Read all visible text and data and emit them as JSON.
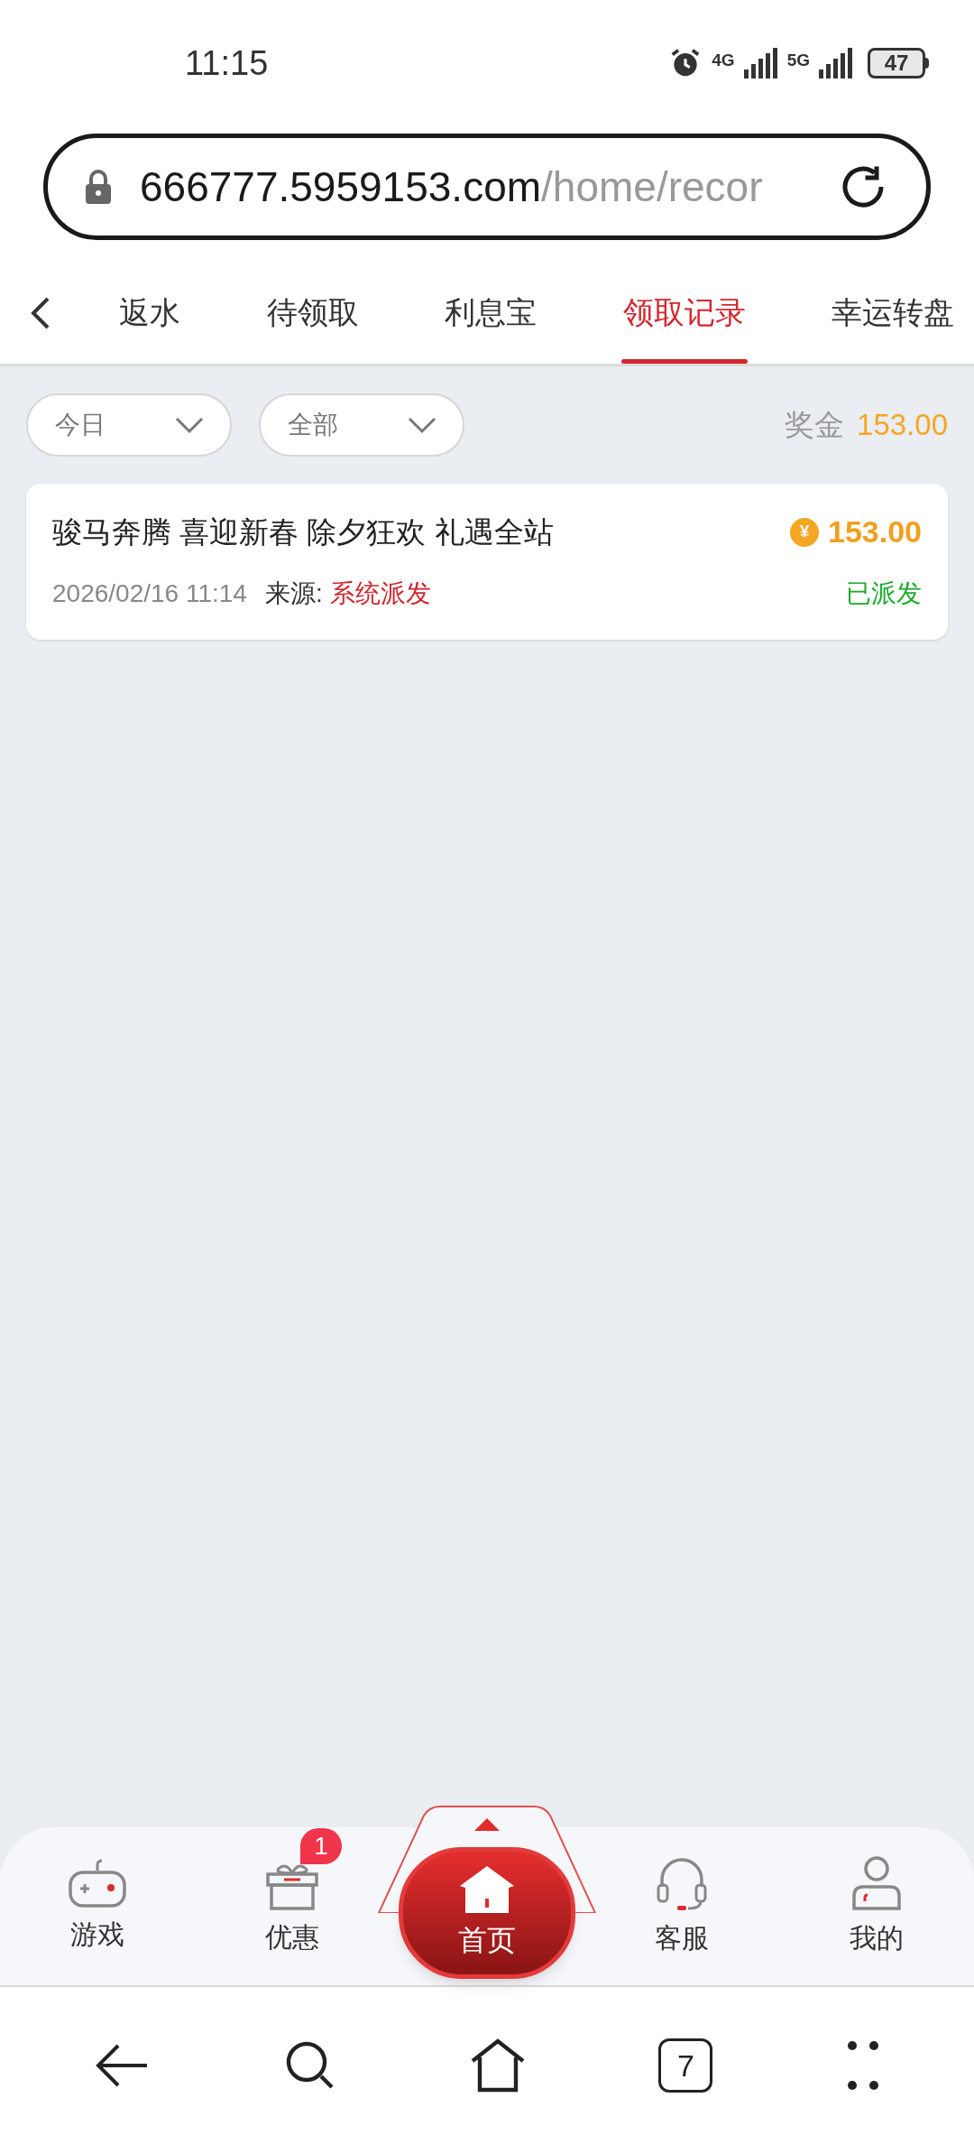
{
  "status_bar": {
    "time": "11:15",
    "network_1": "4G",
    "network_2": "5G",
    "battery": "47"
  },
  "address_bar": {
    "domain": "666777.5959153.com",
    "path": "/home/recor"
  },
  "tabs": [
    {
      "label": "返水",
      "selected": false
    },
    {
      "label": "待领取",
      "selected": false
    },
    {
      "label": "利息宝",
      "selected": false
    },
    {
      "label": "领取记录",
      "selected": true
    },
    {
      "label": "幸运转盘",
      "selected": false
    }
  ],
  "filters": [
    {
      "value": "今日"
    },
    {
      "value": "全部"
    }
  ],
  "bonus_total": {
    "label": "奖金",
    "amount": "153.00"
  },
  "records": [
    {
      "title": "骏马奔腾 喜迎新春 除夕狂欢 礼遇全站",
      "currency_symbol": "¥",
      "amount": "153.00",
      "time": "2026/02/16 11:14",
      "source_label": "来源:",
      "source": "系统派发",
      "status": "已派发"
    }
  ],
  "bottom_nav": [
    {
      "label": "游戏",
      "kind": "tab"
    },
    {
      "label": "优惠",
      "kind": "tab",
      "badge": "1"
    },
    {
      "label": "首页",
      "kind": "center"
    },
    {
      "label": "客服",
      "kind": "tab"
    },
    {
      "label": "我的",
      "kind": "tab"
    }
  ],
  "browser_toolbar": {
    "tab_count": "7"
  }
}
